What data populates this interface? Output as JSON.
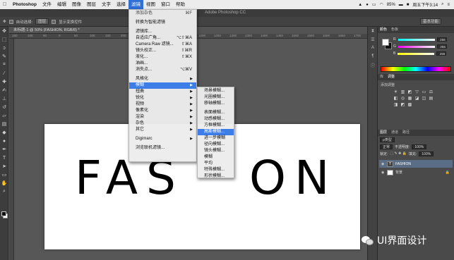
{
  "mac_menubar": {
    "apple": "",
    "items": [
      "Photoshop",
      "文件",
      "编辑",
      "图像",
      "图层",
      "文字",
      "选择",
      "滤镜",
      "视图",
      "窗口",
      "帮助"
    ],
    "active_index": 7,
    "battery": "85%",
    "clock": "周五下午3:14"
  },
  "ps_window_title": "Adobe Photoshop CC",
  "options_bar": {
    "auto_select_label": "自动选择:",
    "auto_select_value": "图层",
    "show_transform_label": "显示变换控件",
    "workspace": "基本功能"
  },
  "document": {
    "tab_title": "未标题-1 @ 50% (FASHION, RGB/8) *",
    "canvas_text_left": "FAS",
    "canvas_text_right": "ON",
    "ruler_ticks": [
      "150",
      "100",
      "50",
      "0",
      "50",
      "100",
      "150",
      "200",
      "250",
      "300",
      "1100",
      "1150",
      "1200",
      "1250",
      "1300",
      "1350",
      "1400",
      "1450",
      "1500",
      "1550",
      "1600",
      "1650",
      "1700",
      "1750"
    ]
  },
  "filter_menu": {
    "items": [
      {
        "label": "添加杂色",
        "shortcut": "⌘F",
        "dim": true
      },
      {
        "sep": true
      },
      {
        "label": "转换为智能滤镜"
      },
      {
        "sep": true
      },
      {
        "label": "滤镜库..."
      },
      {
        "label": "自适应广角...",
        "shortcut": "⌥⇧⌘A"
      },
      {
        "label": "Camera Raw 滤镜...",
        "shortcut": "⇧⌘A"
      },
      {
        "label": "镜头校正...",
        "shortcut": "⇧⌘R"
      },
      {
        "label": "液化...",
        "shortcut": "⇧⌘X"
      },
      {
        "label": "油画..."
      },
      {
        "label": "消失点...",
        "shortcut": "⌥⌘V"
      },
      {
        "sep": true
      },
      {
        "label": "风格化",
        "submenu": true
      },
      {
        "label": "模糊",
        "submenu": true,
        "highlight": true
      },
      {
        "label": "扭曲",
        "submenu": true
      },
      {
        "label": "锐化",
        "submenu": true
      },
      {
        "label": "视频",
        "submenu": true
      },
      {
        "label": "像素化",
        "submenu": true
      },
      {
        "label": "渲染",
        "submenu": true
      },
      {
        "label": "杂色",
        "submenu": true
      },
      {
        "label": "其它",
        "submenu": true
      },
      {
        "sep": true
      },
      {
        "label": "Digimarc",
        "submenu": true
      },
      {
        "sep": true
      },
      {
        "label": "浏览联机滤镜..."
      }
    ]
  },
  "blur_submenu": {
    "items": [
      {
        "label": "场景模糊..."
      },
      {
        "label": "光圈模糊..."
      },
      {
        "label": "移轴模糊..."
      },
      {
        "sep": true
      },
      {
        "label": "表面模糊..."
      },
      {
        "label": "动感模糊..."
      },
      {
        "label": "方框模糊..."
      },
      {
        "label": "高斯模糊...",
        "highlight": true
      },
      {
        "label": "进一步模糊"
      },
      {
        "label": "径向模糊..."
      },
      {
        "label": "镜头模糊..."
      },
      {
        "label": "模糊"
      },
      {
        "label": "平均"
      },
      {
        "label": "特殊模糊..."
      },
      {
        "label": "形状模糊..."
      }
    ]
  },
  "color_panel": {
    "tabs": [
      "颜色",
      "色板"
    ],
    "r": "255",
    "g": "255",
    "b": "255"
  },
  "adjust_panel": {
    "tabs": [
      "库",
      "调整"
    ],
    "label": "添加调整",
    "icons": [
      "☀",
      "▥",
      "◩",
      "▽",
      "▭",
      "⚖",
      "◧",
      "◎",
      "▦",
      "◪",
      "◫",
      "▤",
      "◨",
      "◩",
      "▩"
    ]
  },
  "layers_panel": {
    "tabs": [
      "图层",
      "通道",
      "路径"
    ],
    "kind": "ρ类型",
    "blend_mode": "正常",
    "opacity_label": "不透明度:",
    "opacity": "100%",
    "lock_label": "锁定:",
    "fill_label": "填充:",
    "fill": "100%",
    "layers": [
      {
        "name": "FASHION",
        "thumb": "T",
        "active": true
      },
      {
        "name": "背景",
        "thumb": "",
        "active": false
      }
    ]
  },
  "watermark": {
    "text": "UI界面设计"
  }
}
